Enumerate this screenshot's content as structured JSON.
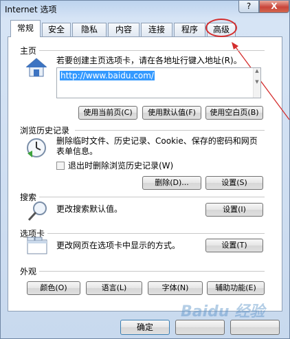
{
  "window": {
    "title": "Internet 选项",
    "help": "?",
    "close": "X"
  },
  "tabs": [
    "常规",
    "安全",
    "隐私",
    "内容",
    "连接",
    "程序",
    "高级"
  ],
  "home": {
    "section": "主页",
    "desc": "若要创建主页选项卡，请在各地址行键入地址(R)。",
    "url": "http://www.baidu.com/",
    "btn_current": "使用当前页(C)",
    "btn_default": "使用默认值(F)",
    "btn_blank": "使用空白页(B)"
  },
  "history": {
    "section": "浏览历史记录",
    "desc1": "删除临时文件、历史记录、Cookie、保存的密码和网页",
    "desc2": "表单信息。",
    "checkbox": "退出时删除浏览历史记录(W)",
    "btn_delete": "删除(D)...",
    "btn_settings": "设置(S)"
  },
  "search": {
    "section": "搜索",
    "desc": "更改搜索默认值。",
    "btn_settings": "设置(I)"
  },
  "tabs_section": {
    "section": "选项卡",
    "desc": "更改网页在选项卡中显示的方式。",
    "btn_settings": "设置(T)"
  },
  "appearance": {
    "section": "外观",
    "btn_colors": "颜色(O)",
    "btn_languages": "语言(L)",
    "btn_fonts": "字体(N)",
    "btn_accessibility": "辅助功能(E)"
  },
  "footer": {
    "btn_ok": "确定"
  },
  "watermark": "Baidu 经验",
  "colors": {
    "highlight": "#d42d2d",
    "selection": "#3399ff"
  }
}
